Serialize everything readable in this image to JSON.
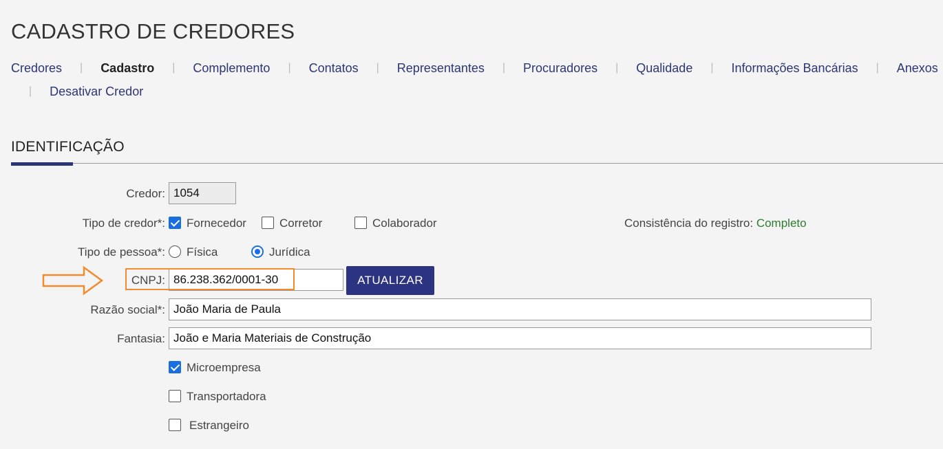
{
  "page_title": "CADASTRO DE CREDORES",
  "tabs": [
    {
      "label": "Credores",
      "active": false
    },
    {
      "label": "Cadastro",
      "active": true
    },
    {
      "label": "Complemento",
      "active": false
    },
    {
      "label": "Contatos",
      "active": false
    },
    {
      "label": "Representantes",
      "active": false
    },
    {
      "label": "Procuradores",
      "active": false
    },
    {
      "label": "Qualidade",
      "active": false
    },
    {
      "label": "Informações Bancárias",
      "active": false
    },
    {
      "label": "Anexos",
      "active": false
    },
    {
      "label": "Desativar Credor",
      "active": false
    }
  ],
  "tab_separator": "|",
  "section_title": "IDENTIFICAÇÃO",
  "form": {
    "credor_label": "Credor:",
    "credor_value": "1054",
    "tipo_credor_label": "Tipo de credor*:",
    "tipo_credor_options": [
      {
        "label": "Fornecedor",
        "checked": true
      },
      {
        "label": "Corretor",
        "checked": false
      },
      {
        "label": "Colaborador",
        "checked": false
      }
    ],
    "consistencia_label": "Consistência do registro:",
    "consistencia_value": "Completo",
    "tipo_pessoa_label": "Tipo de pessoa*:",
    "tipo_pessoa_options": [
      {
        "label": "Física",
        "selected": false
      },
      {
        "label": "Jurídica",
        "selected": true
      }
    ],
    "cnpj_label": "CNPJ:",
    "cnpj_value": "86.238.362/0001-30",
    "atualizar_label": "ATUALIZAR",
    "razao_social_label": "Razão social*:",
    "razao_social_value": "João Maria de Paula",
    "fantasia_label": "Fantasia:",
    "fantasia_value": "João e Maria Materiais de Construção",
    "flags": [
      {
        "label": "Microempresa",
        "checked": true
      },
      {
        "label": "Transportadora",
        "checked": false
      },
      {
        "label": "Estrangeiro",
        "checked": false
      }
    ]
  },
  "colors": {
    "accent": "#2c3575",
    "checkbox_on": "#1a6fe0",
    "highlight": "#f28a2e",
    "status_ok": "#2e7d32"
  },
  "icons": {
    "annotation_arrow": "arrow-right-outline-icon"
  }
}
